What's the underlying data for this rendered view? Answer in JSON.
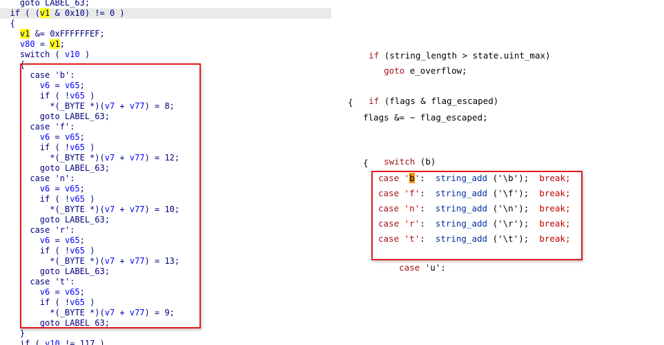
{
  "left_code": {
    "lines": [
      {
        "t": "    goto LABEL_63;"
      },
      {
        "t": "  if ( (v1 & 0x10) != 0 )"
      },
      {
        "t": "  {"
      },
      {
        "t": "    v1 &= 0xFFFFFFEF;"
      },
      {
        "t": "    v80 = v1;"
      },
      {
        "t": "    switch ( v10 )"
      },
      {
        "t": "    {"
      },
      {
        "t": "      case 'b':"
      },
      {
        "t": "        v6 = v65;"
      },
      {
        "t": "        if ( !v65 )"
      },
      {
        "t": "          *(_BYTE *)(v7 + v77) = 8;"
      },
      {
        "t": "        goto LABEL_63;"
      },
      {
        "t": "      case 'f':"
      },
      {
        "t": "        v6 = v65;"
      },
      {
        "t": "        if ( !v65 )"
      },
      {
        "t": "          *(_BYTE *)(v7 + v77) = 12;"
      },
      {
        "t": "        goto LABEL_63;"
      },
      {
        "t": "      case 'n':"
      },
      {
        "t": "        v6 = v65;"
      },
      {
        "t": "        if ( !v65 )"
      },
      {
        "t": "          *(_BYTE *)(v7 + v77) = 10;"
      },
      {
        "t": "        goto LABEL_63;"
      },
      {
        "t": "      case 'r':"
      },
      {
        "t": "        v6 = v65;"
      },
      {
        "t": "        if ( !v65 )"
      },
      {
        "t": "          *(_BYTE *)(v7 + v77) = 13;"
      },
      {
        "t": "        goto LABEL_63;"
      },
      {
        "t": "      case 't':"
      },
      {
        "t": "        v6 = v65;"
      },
      {
        "t": "        if ( !v65 )"
      },
      {
        "t": "          *(_BYTE *)(v7 + v77) = 9;"
      },
      {
        "t": "        goto LABEL_63;"
      },
      {
        "t": "    }"
      },
      {
        "t": "    if ( v10 != 117 )"
      }
    ]
  },
  "right_code": {
    "if_overflow": "if (string_length > state.uint_max)",
    "goto_overflow": "goto e_overflow;",
    "if_flags": "if (flags & flag_escaped)",
    "open_brace": "{",
    "flags_clear": "flags &= ~ flag_escaped;",
    "switch_b": "switch (b)",
    "open_brace2": "{",
    "cases": [
      {
        "label": "'b'",
        "call": "string_add",
        "arg": "('\\b');",
        "brk": "break;"
      },
      {
        "label": "'f'",
        "call": "string_add",
        "arg": "('\\f');",
        "brk": "break;"
      },
      {
        "label": "'n'",
        "call": "string_add",
        "arg": "('\\n');",
        "brk": "break;"
      },
      {
        "label": "'r'",
        "call": "string_add",
        "arg": "('\\r');",
        "brk": "break;"
      },
      {
        "label": "'t'",
        "call": "string_add",
        "arg": "('\\t');",
        "brk": "break;"
      }
    ],
    "case_u": "case 'u':",
    "case_kw": "case"
  },
  "colors": {
    "highlight_box": "#e0191b",
    "yellow_highlight": "#ffff00",
    "orange_highlight": "#ff8c00",
    "current_line": "#e9e9e9"
  }
}
